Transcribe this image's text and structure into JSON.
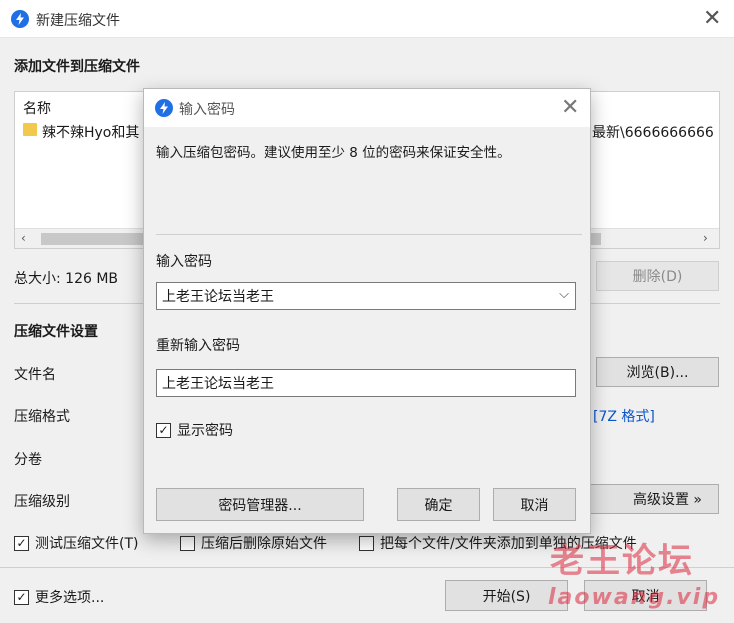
{
  "window": {
    "title": "新建压缩文件",
    "close": "✕"
  },
  "add_section": {
    "title": "添加文件到压缩文件",
    "column_name": "名称",
    "file_item_left": "辣不辣Hyo和其",
    "file_item_right": "最新\\6666666666"
  },
  "total_size": "总大小: 126 MB",
  "delete_button": "删除(D)",
  "settings": {
    "title": "压缩文件设置",
    "filename_label": "文件名",
    "browse_button": "浏览(B)...",
    "format_label": "压缩格式",
    "format_link": "[7Z 格式]",
    "split_label": "分卷",
    "level_label": "压缩级别",
    "advanced_button": "高级设置 »"
  },
  "options": {
    "test_archive": "测试压缩文件(T)",
    "test_archive_checked": true,
    "delete_after": "压缩后删除原始文件",
    "delete_after_checked": false,
    "separate_archives": "把每个文件/文件夹添加到单独的压缩文件",
    "separate_archives_checked": false,
    "more_options": "更多选项...",
    "more_options_checked": true
  },
  "footer": {
    "start_button": "开始(S)",
    "cancel_button": "取消"
  },
  "password_dialog": {
    "title": "输入密码",
    "close": "✕",
    "instruction": "输入压缩包密码。建议使用至少 8 位的密码来保证安全性。",
    "password_label": "输入密码",
    "password_value": "上老王论坛当老王",
    "confirm_label": "重新输入密码",
    "confirm_value": "上老王论坛当老王",
    "show_password": "显示密码",
    "show_password_checked": true,
    "manager_button": "密码管理器...",
    "ok_button": "确定",
    "cancel_button": "取消"
  },
  "watermark": {
    "top": "老王论坛",
    "bottom": "laowang.vip"
  },
  "colors": {
    "accent": "#1f6fe5",
    "link": "#0b56c9",
    "window_bg": "#f0f0f0"
  }
}
